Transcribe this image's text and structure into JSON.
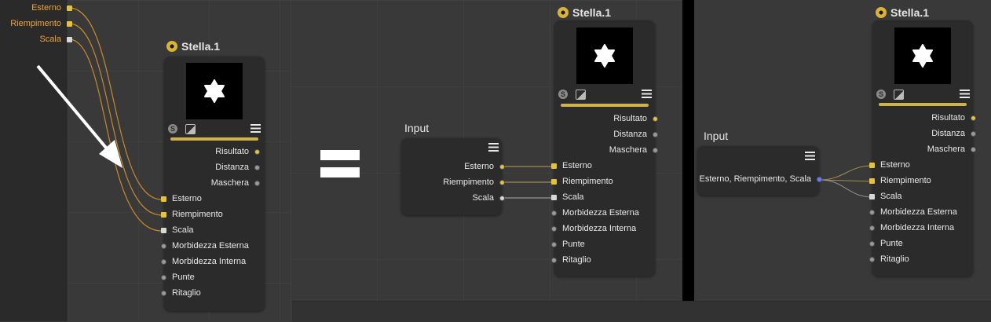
{
  "left_panel": {
    "inputs": [
      {
        "label": "Esterno",
        "color": "#e6c23a"
      },
      {
        "label": "Riempimento",
        "color": "#e6c23a"
      },
      {
        "label": "Scala",
        "color": "#d8d8d8"
      }
    ]
  },
  "node_title": "Stella.1",
  "node_inputs": [
    "Esterno",
    "Riempimento",
    "Scala",
    "Morbidezza Esterna",
    "Morbidezza Interna",
    "Punte",
    "Ritaglio"
  ],
  "node_outputs": [
    "Risultato",
    "Distanza",
    "Maschera"
  ],
  "mid_input_node": {
    "title": "Input",
    "ports": [
      "Esterno",
      "Riempimento",
      "Scala"
    ]
  },
  "right_input_node": {
    "title": "Input",
    "combined_port": "Esterno, Riempimento, Scala"
  },
  "colors": {
    "accent_gold": "#cdb34a",
    "port_yellow": "#e6c23a",
    "port_blue": "#6f7de8",
    "wire_orange": "#c9892a"
  },
  "icons": [
    "stella-node-icon",
    "menu-icon",
    "s-tool-icon",
    "image-icon",
    "white-arrow",
    "equals-sign"
  ]
}
